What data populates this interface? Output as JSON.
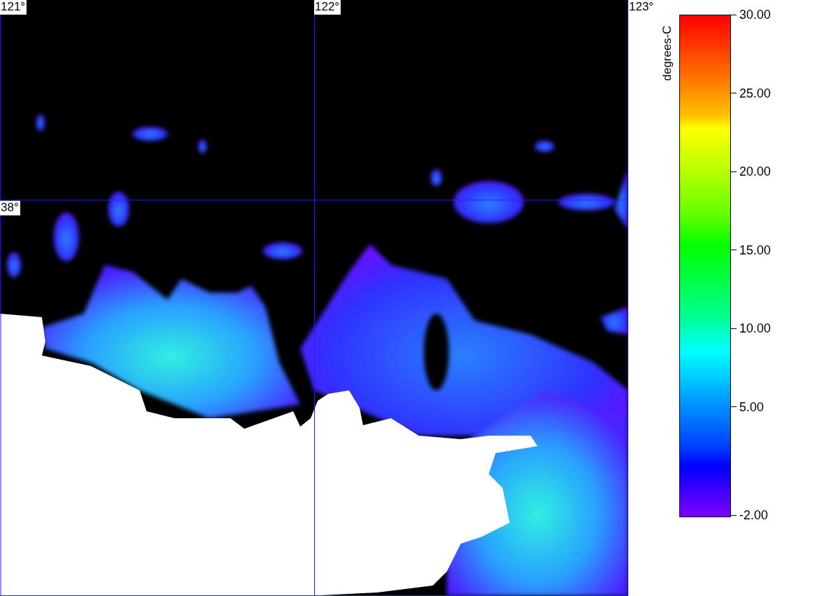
{
  "map": {
    "longitude_labels": [
      "121°",
      "122°",
      "123°"
    ],
    "latitude_labels": [
      "38°"
    ]
  },
  "colorbar": {
    "title": "degrees-C",
    "ticks": [
      "30.00",
      "25.00",
      "20.00",
      "15.00",
      "10.00",
      "5.00",
      "-2.00"
    ]
  }
}
